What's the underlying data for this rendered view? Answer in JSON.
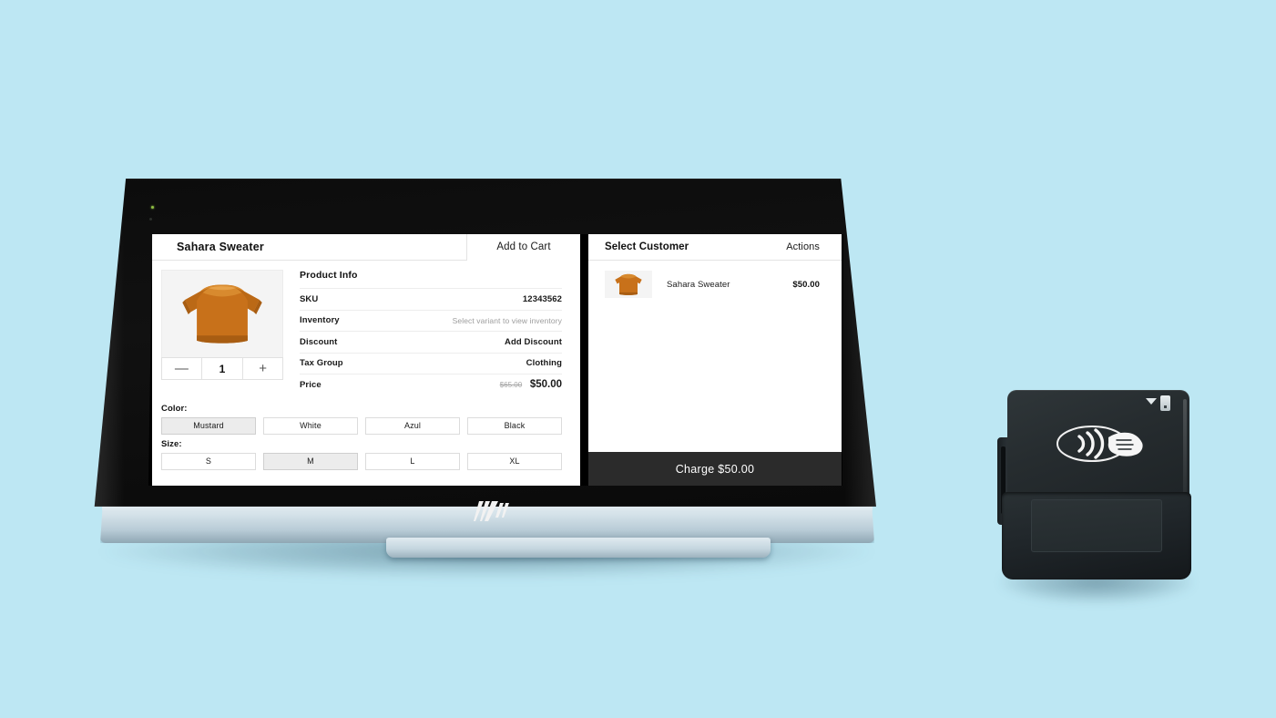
{
  "scene": {
    "background_color": "#bde7f3",
    "device_name": "hp-point-of-sale-terminal",
    "logo": "hp-logo",
    "peripheral": "contactless-card-reader"
  },
  "product_panel": {
    "title": "Sahara Sweater",
    "add_to_cart_label": "Add to Cart",
    "product_image_alt": "mustard-crewneck-sweater",
    "quantity": {
      "decrement_label": "—",
      "value": "1",
      "increment_label": "+"
    },
    "info_heading": "Product Info",
    "info_rows": [
      {
        "key": "SKU",
        "value": "12343562",
        "muted": false
      },
      {
        "key": "Inventory",
        "value": "Select variant to view inventory",
        "muted": true
      },
      {
        "key": "Discount",
        "value": "Add Discount",
        "muted": false
      },
      {
        "key": "Tax Group",
        "value": "Clothing",
        "muted": false
      }
    ],
    "price_row": {
      "key": "Price",
      "original": "$65.00",
      "current": "$50.00"
    },
    "color": {
      "label": "Color:",
      "options": [
        "Mustard",
        "White",
        "Azul",
        "Black"
      ],
      "selected": "Mustard"
    },
    "size": {
      "label": "Size:",
      "options": [
        "S",
        "M",
        "L",
        "XL"
      ],
      "selected": "M"
    }
  },
  "cart_panel": {
    "select_customer_label": "Select Customer",
    "actions_label": "Actions",
    "items": [
      {
        "name": "Sahara Sweater",
        "price": "$50.00",
        "thumb_alt": "mustard-crewneck-sweater"
      }
    ],
    "charge_label": "Charge $50.00"
  },
  "colors": {
    "sweater": "#c8711a",
    "charge_bar": "#2b2b2b",
    "selected_variant": "#ececec",
    "muted_text": "#9d9d9d"
  }
}
